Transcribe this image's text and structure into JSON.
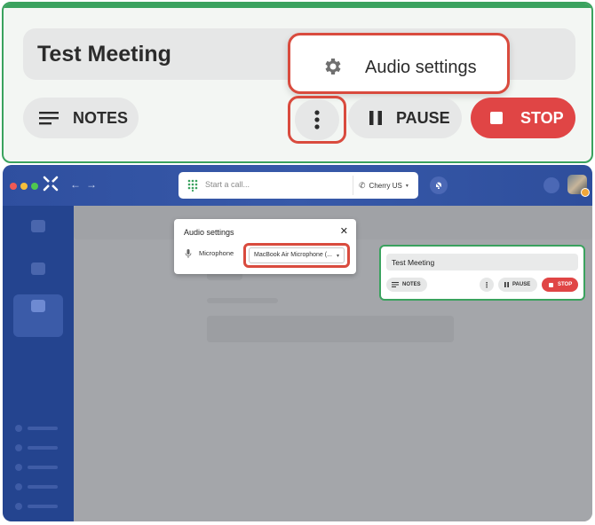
{
  "zoom": {
    "meeting_title": "Test Meeting",
    "audio_settings_label": "Audio settings",
    "notes_label": "NOTES",
    "pause_label": "PAUSE",
    "stop_label": "STOP"
  },
  "app": {
    "call_placeholder": "Start a call...",
    "region_label": "Cherry US",
    "audio_dialog": {
      "title": "Audio settings",
      "close_glyph": "✕",
      "microphone_label": "Microphone",
      "microphone_value": "MacBook Air Microphone (...",
      "caret": "▾"
    },
    "mini_widget": {
      "title": "Test Meeting",
      "notes_label": "NOTES",
      "more_glyph": "⋮",
      "pause_label": "PAUSE",
      "stop_label": "STOP"
    },
    "nav": {
      "back_glyph": "←",
      "forward_glyph": "→"
    }
  },
  "colors": {
    "accent_green": "#3aa25e",
    "highlight_red": "#d94b3e",
    "stop_red": "#e04545",
    "app_blue": "#2f4f9f"
  },
  "icons": [
    "gear-icon",
    "notes-lines-icon",
    "more-vertical-icon",
    "pause-icon",
    "stop-square-icon",
    "dialpad-icon",
    "phone-icon",
    "bell-off-icon",
    "microphone-icon",
    "close-icon",
    "app-logo-icon"
  ]
}
